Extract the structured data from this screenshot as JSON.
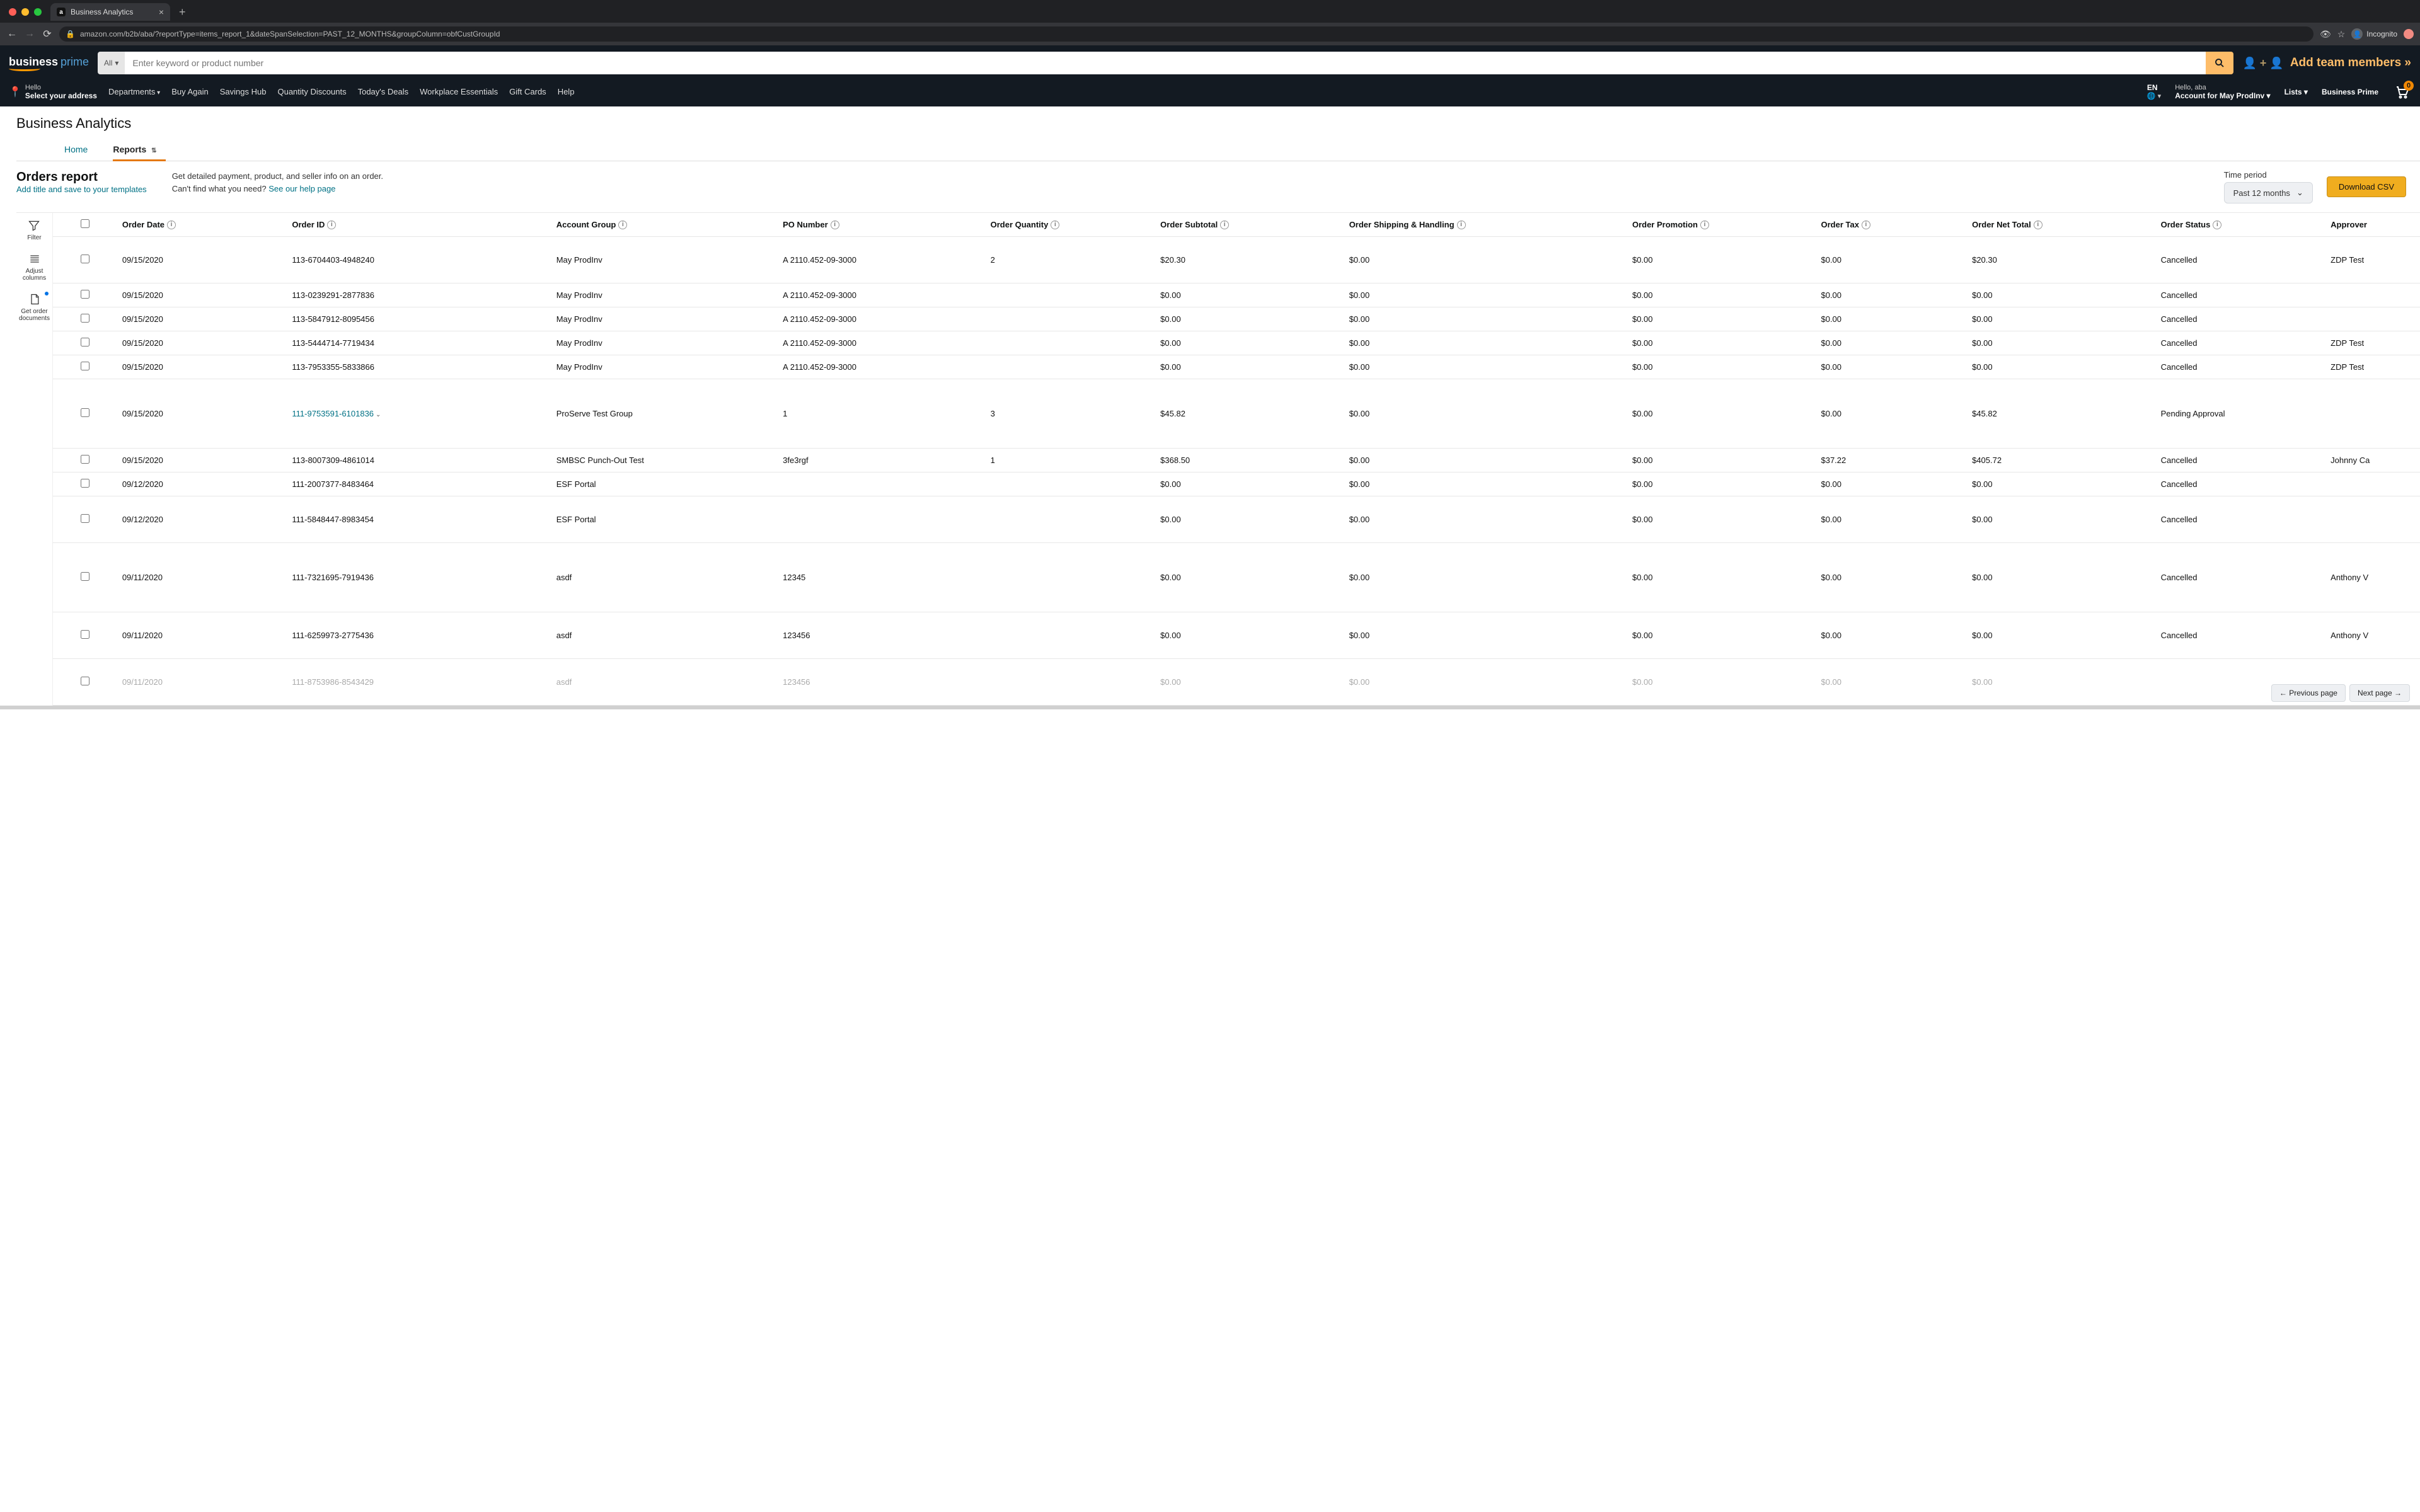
{
  "browser": {
    "tab_title": "Business Analytics",
    "url_display": "amazon.com/b2b/aba/?reportType=items_report_1&dateSpanSelection=PAST_12_MONTHS&groupColumn=obfCustGroupId",
    "incognito_label": "Incognito"
  },
  "header": {
    "brand_main": "business",
    "brand_sub": "prime",
    "search_category": "All",
    "search_placeholder": "Enter keyword or product number",
    "team_add_label": "Add team members »",
    "deliver_hello": "Hello",
    "deliver_action": "Select your address",
    "nav": [
      "Departments",
      "Buy Again",
      "Savings Hub",
      "Quantity Discounts",
      "Today's Deals",
      "Workplace Essentials",
      "Gift Cards",
      "Help"
    ],
    "lang": "EN",
    "greeting": "Hello, aba",
    "account_label": "Account for May ProdInv",
    "lists_label": "Lists",
    "bp_label": "Business Prime",
    "cart_count": "0"
  },
  "page": {
    "title": "Business Analytics",
    "tab_home": "Home",
    "tab_reports": "Reports",
    "report_title": "Orders report",
    "save_template_link": "Add title and save to your templates",
    "info_line1": "Get detailed payment, product, and seller info on an order.",
    "info_line2a": "Can't find what you need? ",
    "info_line2_link": "See our help page",
    "time_period_label": "Time period",
    "time_period_value": "Past 12 months",
    "download_label": "Download CSV"
  },
  "tools": {
    "filter": "Filter",
    "adjust": "Adjust columns",
    "docs": "Get order documents"
  },
  "columns": [
    "Order Date",
    "Order ID",
    "Account Group",
    "PO Number",
    "Order Quantity",
    "Order Subtotal",
    "Order Shipping & Handling",
    "Order Promotion",
    "Order Tax",
    "Order Net Total",
    "Order Status",
    "Approver"
  ],
  "rows": [
    {
      "date": "09/15/2020",
      "oid": "113-6704403-4948240",
      "group": "May ProdInv",
      "po": "A 2110.452-09-3000",
      "qty": "2",
      "sub": "$20.30",
      "ship": "$0.00",
      "prom": "$0.00",
      "tax": "$0.00",
      "net": "$20.30",
      "status": "Cancelled",
      "approver": "ZDP Test ",
      "link": false,
      "rowclass": "med"
    },
    {
      "date": "09/15/2020",
      "oid": "113-0239291-2877836",
      "group": "May ProdInv",
      "po": "A 2110.452-09-3000",
      "qty": "",
      "sub": "$0.00",
      "ship": "$0.00",
      "prom": "$0.00",
      "tax": "$0.00",
      "net": "$0.00",
      "status": "Cancelled",
      "approver": "",
      "link": false,
      "rowclass": ""
    },
    {
      "date": "09/15/2020",
      "oid": "113-5847912-8095456",
      "group": "May ProdInv",
      "po": "A 2110.452-09-3000",
      "qty": "",
      "sub": "$0.00",
      "ship": "$0.00",
      "prom": "$0.00",
      "tax": "$0.00",
      "net": "$0.00",
      "status": "Cancelled",
      "approver": "",
      "link": false,
      "rowclass": ""
    },
    {
      "date": "09/15/2020",
      "oid": "113-5444714-7719434",
      "group": "May ProdInv",
      "po": "A 2110.452-09-3000",
      "qty": "",
      "sub": "$0.00",
      "ship": "$0.00",
      "prom": "$0.00",
      "tax": "$0.00",
      "net": "$0.00",
      "status": "Cancelled",
      "approver": "ZDP Test ",
      "link": false,
      "rowclass": ""
    },
    {
      "date": "09/15/2020",
      "oid": "113-7953355-5833866",
      "group": "May ProdInv",
      "po": "A 2110.452-09-3000",
      "qty": "",
      "sub": "$0.00",
      "ship": "$0.00",
      "prom": "$0.00",
      "tax": "$0.00",
      "net": "$0.00",
      "status": "Cancelled",
      "approver": "ZDP Test ",
      "link": false,
      "rowclass": ""
    },
    {
      "date": "09/15/2020",
      "oid": "111-9753591-6101836",
      "group": "ProServe Test Group",
      "po": "1",
      "qty": "3",
      "sub": "$45.82",
      "ship": "$0.00",
      "prom": "$0.00",
      "tax": "$0.00",
      "net": "$45.82",
      "status": "Pending Approval",
      "approver": "",
      "link": true,
      "rowclass": "tall"
    },
    {
      "date": "09/15/2020",
      "oid": "113-8007309-4861014",
      "group": "SMBSC Punch-Out Test",
      "po": "3fe3rgf",
      "qty": "1",
      "sub": "$368.50",
      "ship": "$0.00",
      "prom": "$0.00",
      "tax": "$37.22",
      "net": "$405.72",
      "status": "Cancelled",
      "approver": "Johnny Ca",
      "link": false,
      "rowclass": ""
    },
    {
      "date": "09/12/2020",
      "oid": "111-2007377-8483464",
      "group": "ESF Portal",
      "po": "",
      "qty": "",
      "sub": "$0.00",
      "ship": "$0.00",
      "prom": "$0.00",
      "tax": "$0.00",
      "net": "$0.00",
      "status": "Cancelled",
      "approver": "",
      "link": false,
      "rowclass": ""
    },
    {
      "date": "09/12/2020",
      "oid": "111-5848447-8983454",
      "group": "ESF Portal",
      "po": "",
      "qty": "",
      "sub": "$0.00",
      "ship": "$0.00",
      "prom": "$0.00",
      "tax": "$0.00",
      "net": "$0.00",
      "status": "Cancelled",
      "approver": "",
      "link": false,
      "rowclass": "med"
    },
    {
      "date": "09/11/2020",
      "oid": "111-7321695-7919436",
      "group": "asdf",
      "po": "12345",
      "qty": "",
      "sub": "$0.00",
      "ship": "$0.00",
      "prom": "$0.00",
      "tax": "$0.00",
      "net": "$0.00",
      "status": "Cancelled",
      "approver": "Anthony V",
      "link": false,
      "rowclass": "tall"
    },
    {
      "date": "09/11/2020",
      "oid": "111-6259973-2775436",
      "group": "asdf",
      "po": "123456",
      "qty": "",
      "sub": "$0.00",
      "ship": "$0.00",
      "prom": "$0.00",
      "tax": "$0.00",
      "net": "$0.00",
      "status": "Cancelled",
      "approver": "Anthony V",
      "link": false,
      "rowclass": "med"
    },
    {
      "date": "09/11/2020",
      "oid": "111-8753986-8543429",
      "group": "asdf",
      "po": "123456",
      "qty": "",
      "sub": "$0.00",
      "ship": "$0.00",
      "prom": "$0.00",
      "tax": "$0.00",
      "net": "$0.00",
      "status": "",
      "approver": "",
      "link": false,
      "rowclass": "faded med"
    }
  ],
  "pager": {
    "prev": "← Previous page",
    "next": "Next page →"
  }
}
